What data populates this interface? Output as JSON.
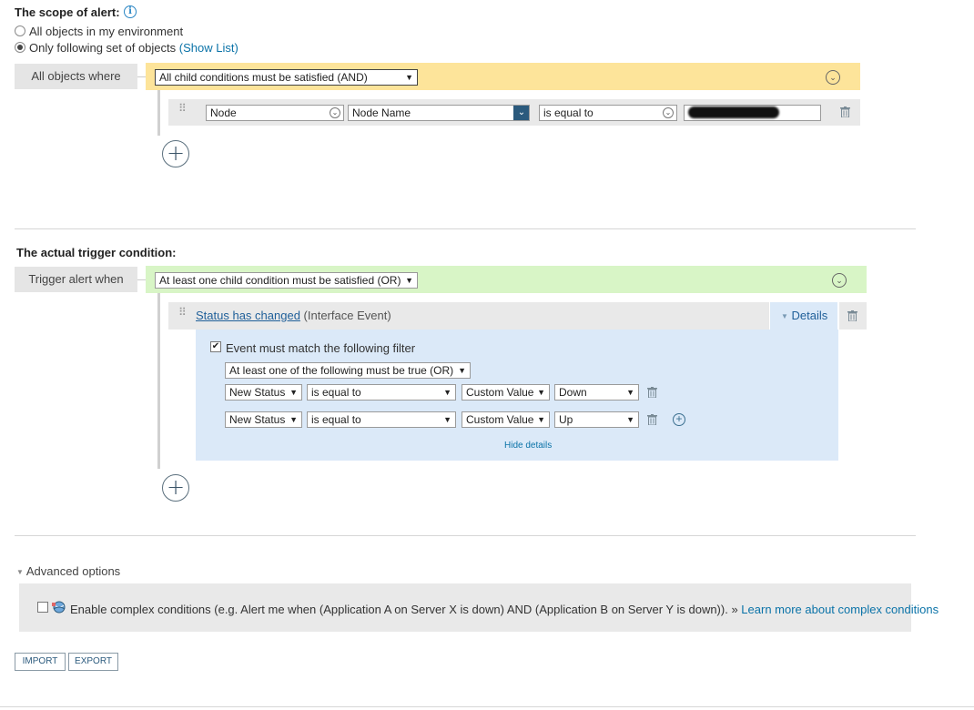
{
  "scope": {
    "title": "The scope of alert:",
    "option_all": "All objects in my environment",
    "option_following": "Only following set of objects",
    "show_list": "(Show List)",
    "where_label": "All objects where",
    "condition_select": "All child conditions must be satisfied (AND)",
    "row": {
      "object": "Node",
      "field": "Node Name",
      "operator": "is equal to",
      "value": ""
    }
  },
  "trigger": {
    "title": "The actual trigger condition:",
    "when_label": "Trigger alert when",
    "condition_select": "At least one child condition must be satisfied (OR)",
    "event": {
      "link": "Status has changed",
      "type": "(Interface Event)",
      "details_label": "Details"
    },
    "filter": {
      "checkbox_label": "Event must match the following filter",
      "group_select": "At least one of the following must be true (OR)",
      "rows": [
        {
          "field": "New Status",
          "operator": "is equal to",
          "source": "Custom Value",
          "value": "Down"
        },
        {
          "field": "New Status",
          "operator": "is equal to",
          "source": "Custom Value",
          "value": "Up"
        }
      ],
      "hide_details": "Hide details"
    }
  },
  "advanced": {
    "title": "Advanced options",
    "complex_text": "Enable complex conditions (e.g. Alert me when (Application A on Server X is down) AND (Application B on Server Y is down)). »",
    "learn_more": "Learn more about complex conditions"
  },
  "buttons": {
    "import": "IMPORT",
    "export": "EXPORT"
  },
  "icons": {
    "info": "info-icon",
    "add": "plus-circle-icon",
    "delete": "trash-icon",
    "collapse": "chevron-down-circle-icon",
    "drag": "drag-handle-icon",
    "app": "globe-app-icon"
  },
  "colors": {
    "yellow_bar": "#fde49a",
    "green_bar": "#d8f5c6",
    "details_panel": "#dbe9f8",
    "link": "#0b73a8"
  }
}
